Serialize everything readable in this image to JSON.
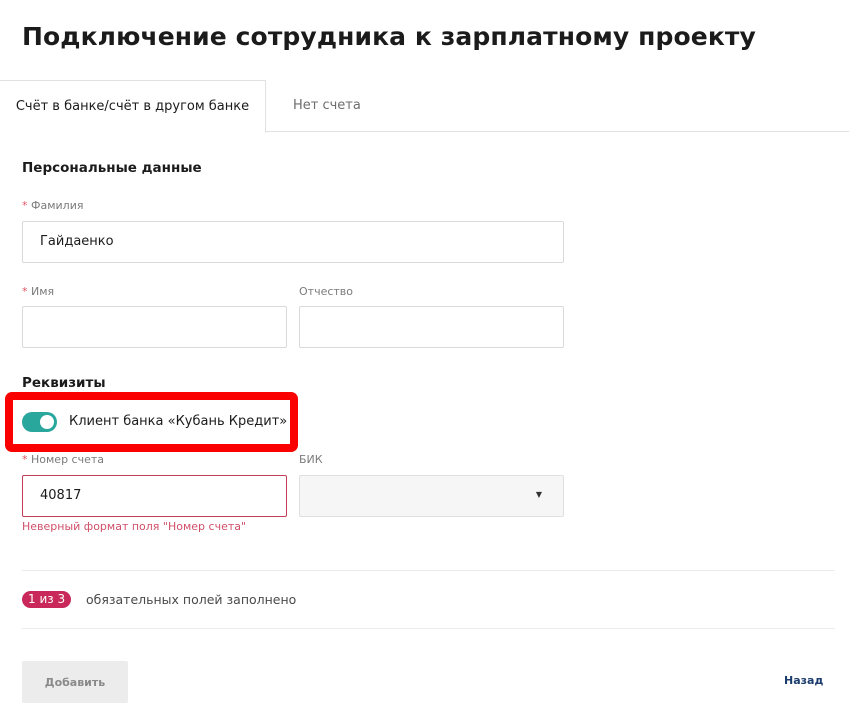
{
  "page": {
    "title": "Подключение сотрудника к зарплатному проекту"
  },
  "tabs": [
    {
      "label": "Счёт в банке/счёт в другом банке",
      "active": true
    },
    {
      "label": "Нет счета",
      "active": false
    }
  ],
  "personal": {
    "section_title": "Персональные данные",
    "surname": {
      "required_mark": "*",
      "label": "Фамилия",
      "value": "Гайдаенко"
    },
    "name": {
      "required_mark": "*",
      "label": "Имя",
      "value": ""
    },
    "patronymic": {
      "label": "Отчество",
      "value": ""
    }
  },
  "requisites": {
    "section_title": "Реквизиты",
    "bank_client_toggle": {
      "label": "Клиент банка «Кубань Кредит»",
      "on": true
    },
    "account_number": {
      "required_mark": "*",
      "label": "Номер счета",
      "value": "40817",
      "error": "Неверный формат поля \"Номер счета\""
    },
    "bik": {
      "label": "БИК",
      "selected": "",
      "caret": "▼"
    }
  },
  "progress": {
    "badge": "1 из 3",
    "text": "обязательных полей заполнено"
  },
  "actions": {
    "add_label": "Добавить",
    "back_label": "Назад"
  },
  "colors": {
    "accent_toggle": "#2aa79c",
    "error": "#c23e56",
    "badge": "#c8285a",
    "highlight": "#fa0000",
    "link": "#1c3c6e"
  }
}
